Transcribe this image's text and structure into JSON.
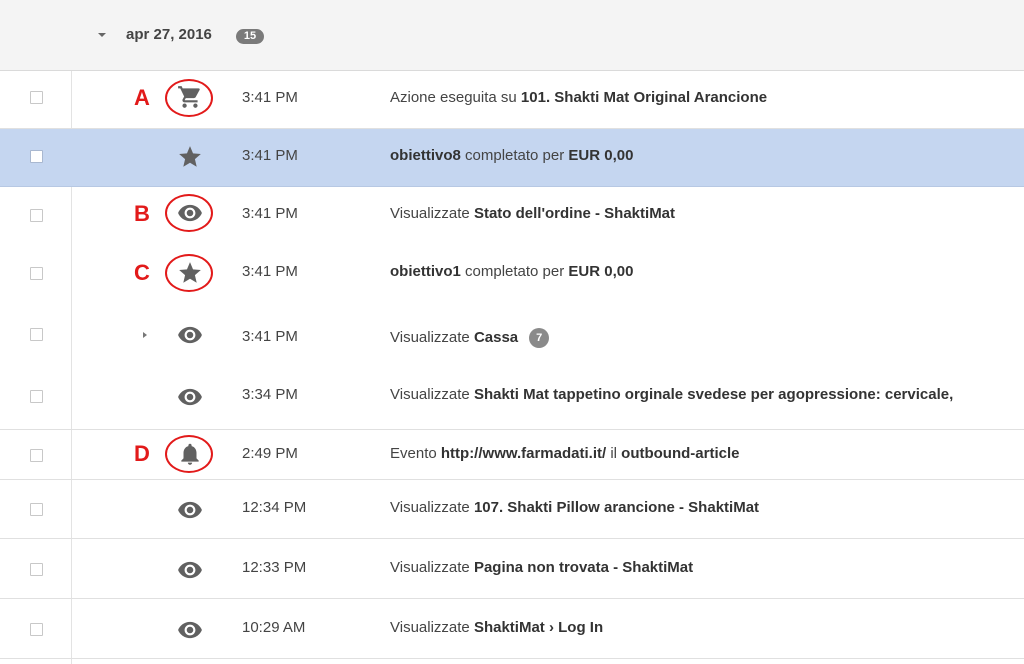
{
  "group": {
    "date": "apr 27, 2016",
    "count": "15"
  },
  "markers": {
    "a": "A",
    "b": "B",
    "c": "C",
    "d": "D"
  },
  "icons": {
    "cart": "shopping-cart-icon",
    "star": "star-icon",
    "eye": "eye-icon",
    "bell": "bell-icon"
  },
  "colors": {
    "selected_row": "#c5d6f0",
    "annotation": "#e21a1a",
    "icon": "#616161",
    "badge": "#7a7a7a"
  },
  "rows": [
    {
      "time": "3:41 PM",
      "icon": "shopping-cart-icon",
      "parts": [
        "Azione eseguita su ",
        "101. Shakti Mat Original Arancione"
      ]
    },
    {
      "time": "3:41 PM",
      "icon": "star-icon",
      "parts": [
        "obiettivo8",
        " completato per ",
        "EUR 0,00"
      ]
    },
    {
      "time": "3:41 PM",
      "icon": "eye-icon",
      "parts": [
        "Visualizzate ",
        "Stato dell'ordine - ShaktiMat"
      ]
    },
    {
      "time": "3:41 PM",
      "icon": "star-icon",
      "parts": [
        "obiettivo1",
        " completato per ",
        "EUR 0,00"
      ]
    },
    {
      "time": "3:41 PM",
      "icon": "eye-icon",
      "parts": [
        "Visualizzate ",
        "Cassa"
      ],
      "badge": "7"
    },
    {
      "time": "3:34 PM",
      "icon": "eye-icon",
      "parts": [
        "Visualizzate ",
        "Shakti Mat tappetino orginale svedese per agopressione: cervicale,"
      ]
    },
    {
      "time": "2:49 PM",
      "icon": "bell-icon",
      "parts": [
        "Evento ",
        "http://www.farmadati.it/",
        " il ",
        "outbound-article"
      ]
    },
    {
      "time": "12:34 PM",
      "icon": "eye-icon",
      "parts": [
        "Visualizzate ",
        "107. Shakti Pillow arancione - ShaktiMat"
      ]
    },
    {
      "time": "12:33 PM",
      "icon": "eye-icon",
      "parts": [
        "Visualizzate ",
        "Pagina non trovata - ShaktiMat"
      ]
    },
    {
      "time": "10:29 AM",
      "icon": "eye-icon",
      "parts": [
        "Visualizzate ",
        "ShaktiMat › Log In"
      ]
    }
  ]
}
